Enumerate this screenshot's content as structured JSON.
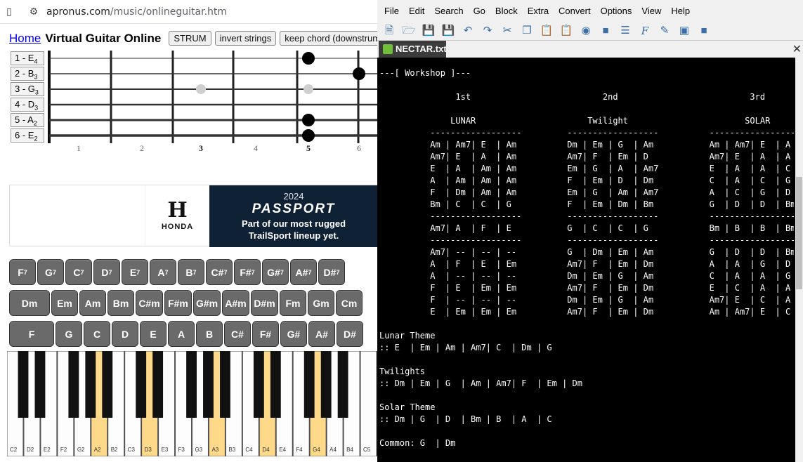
{
  "browser": {
    "url_host": "apronus.com",
    "url_path": "/music/onlineguitar.htm",
    "home_link": "Home",
    "title": "Virtual Guitar Online",
    "buttons": [
      "STRUM",
      "invert strings",
      "keep chord (downstrum"
    ],
    "strings": [
      {
        "num": "1 - E",
        "sub": "4"
      },
      {
        "num": "2 - B",
        "sub": "3"
      },
      {
        "num": "3 - G",
        "sub": "3"
      },
      {
        "num": "4 - D",
        "sub": "3"
      },
      {
        "num": "5 - A",
        "sub": "2"
      },
      {
        "num": "6 - E",
        "sub": "2"
      }
    ],
    "fret_numbers": [
      "1",
      "2",
      "3",
      "4",
      "5",
      "6"
    ],
    "ad": {
      "brand": "HONDA",
      "year": "2024",
      "model": "PASSPORT",
      "tagline1": "Part of our most rugged",
      "tagline2": "TrailSport lineup yet."
    },
    "chord_row1": [
      "F",
      "G",
      "C",
      "D",
      "E",
      "A",
      "B",
      "C#",
      "F#",
      "G#",
      "A#",
      "D#"
    ],
    "chord_row1_sup": "7",
    "chord_row2": [
      "Dm",
      "Em",
      "Am",
      "Bm",
      "C#m",
      "F#m",
      "G#m",
      "A#m",
      "D#m",
      "Fm",
      "Gm",
      "Cm"
    ],
    "chord_row3": [
      "F",
      "G",
      "C",
      "D",
      "E",
      "A",
      "B",
      "C#",
      "F#",
      "G#",
      "A#",
      "D#"
    ],
    "piano_keys": [
      "C2",
      "D2",
      "E2",
      "F2",
      "G2",
      "A2",
      "B2",
      "C3",
      "D3",
      "E3",
      "F3",
      "G3",
      "A3",
      "B3",
      "C4",
      "D4",
      "E4",
      "F4",
      "G4",
      "A4",
      "B4",
      "C5"
    ]
  },
  "editor": {
    "menu": [
      "File",
      "Edit",
      "Search",
      "Go",
      "Block",
      "Extra",
      "Convert",
      "Options",
      "View",
      "Help"
    ],
    "tab_name": "NECTAR.txt",
    "lines": [
      "---[ Workshop ]---",
      "",
      "               1st                          2nd                          3rd",
      "",
      "              LUNAR                      Twilight                       SOLAR",
      "          ------------------         ------------------          ------------------",
      "          Am | Am7| E  | Am          Dm | Em | G  | Am           Am | Am7| E  | A",
      "          Am7| E  | A  | Am          Am7| F  | Em | D            Am7| E  | A  | A",
      "          E  | A  | Am | Am          Em | G  | A  | Am7          E  | A  | A  | C",
      "          A  | Am | Am | Am          F  | Em | D  | Dm           C  | A  | C  | G",
      "          F  | Dm | Am | Am          Em | G  | Am | Am7          A  | C  | G  | D",
      "          Bm | C  | C  | G           F  | Em | Dm | Bm           G  | D  | D  | Bm",
      "          ------------------         ------------------          ------------------",
      "          Am7| A  | F  | E           G  | C  | C  | G            Bm | B  | B  | Bm",
      "          ------------------         ------------------          ------------------",
      "          Am7| -- | -- | --          G  | Dm | Em | Am           G  | D  | D  | Bm",
      "          A  | F  | E  | Em          Am7| F  | Em | Dm           A  | A  | G  | D",
      "          A  | -- | -- | --          Dm | Em | G  | Am           C  | A  | A  | G",
      "          F  | E  | Em | Em          Am7| F  | Em | Dm           E  | C  | A  | A",
      "          F  | -- | -- | --          Dm | Em | G  | Am           Am7| E  | C  | A",
      "          E  | Em | Em | Em          Am7| F  | Em | Dm           Am | Am7| E  | C",
      "",
      "Lunar Theme",
      ":: E  | Em | Am | Am7| C  | Dm | G",
      "",
      "Twilights",
      ":: Dm | Em | G  | Am | Am7| F  | Em | Dm",
      "",
      "Solar Theme",
      ":: Dm | G  | D  | Bm | B  | A  | C",
      "",
      "Common: G  | Dm"
    ]
  },
  "fretboard_notes": [
    {
      "string": 1,
      "fret": 5,
      "state": "pressed"
    },
    {
      "string": 2,
      "fret": 6,
      "state": "pressed"
    },
    {
      "string": 3,
      "fret": 3,
      "state": "marker"
    },
    {
      "string": 3,
      "fret": 5,
      "state": "marker"
    },
    {
      "string": 5,
      "fret": 5,
      "state": "pressed"
    },
    {
      "string": 6,
      "fret": 5,
      "state": "pressed"
    }
  ],
  "highlighted_white_keys": [
    5,
    8,
    12,
    15,
    18
  ],
  "colors": {
    "editor_bg": "#000000",
    "editor_fg": "#ffffff",
    "highlight_key": "#ffd98a",
    "button_bg": "#6a6a6a"
  }
}
